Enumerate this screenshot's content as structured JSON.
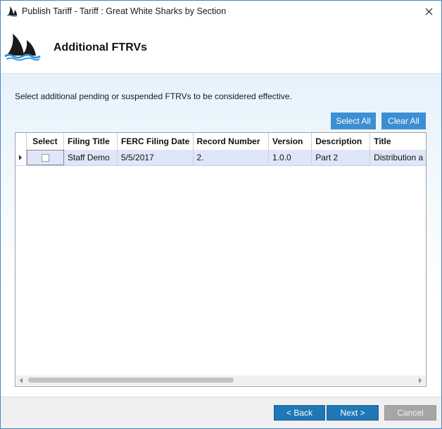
{
  "window": {
    "title": "Publish Tariff - Tariff : Great White Sharks by Section"
  },
  "header": {
    "title": "Additional FTRVs"
  },
  "content": {
    "instruction": "Select additional pending or suspended FTRVs to be considered effective.",
    "select_all_label": "Select All",
    "clear_all_label": "Clear All"
  },
  "grid": {
    "columns": [
      "Select",
      "Filing Title",
      "FERC Filing Date",
      "Record Number",
      "Version",
      "Description",
      "Title"
    ],
    "rows": [
      {
        "selected": false,
        "filing_title": "Staff Demo",
        "ferc_filing_date": "5/5/2017",
        "record_number": "2.",
        "version": "1.0.0",
        "description": "Part 2",
        "title": "Distribution a"
      }
    ]
  },
  "footer": {
    "back_label": "< Back",
    "next_label": "Next >",
    "cancel_label": "Cancel"
  },
  "colors": {
    "accent": "#3b8fd2",
    "footer_button": "#1f77b4",
    "disabled_button": "#a6a6a6",
    "selected_row": "#dfe6f7"
  },
  "icons": {
    "app": "shark-fin-icon",
    "close": "close-icon",
    "logo": "shark-fin-logo-icon",
    "row_indicator": "row-indicator-arrow-icon",
    "scroll_left": "scroll-left-arrow-icon",
    "scroll_right": "scroll-right-arrow-icon"
  }
}
